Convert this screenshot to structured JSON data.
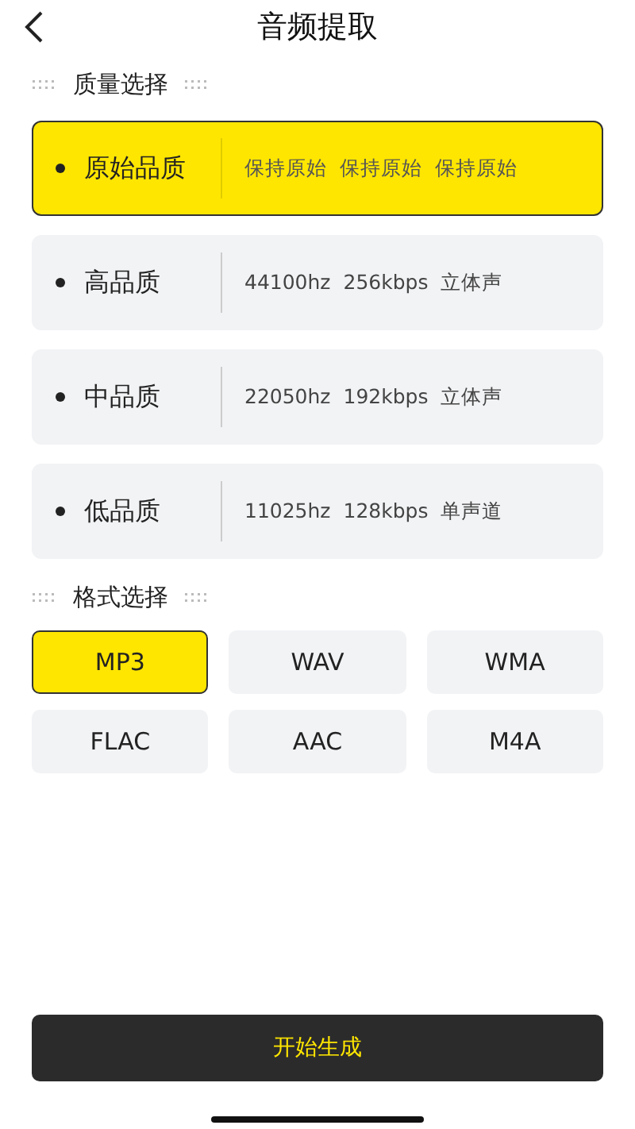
{
  "header": {
    "title": "音频提取"
  },
  "quality_section": {
    "title": "质量选择",
    "options": [
      {
        "name": "原始品质",
        "details": [
          "保持原始",
          "保持原始",
          "保持原始"
        ],
        "selected": true
      },
      {
        "name": "高品质",
        "details": [
          "44100hz",
          "256kbps",
          "立体声"
        ],
        "selected": false
      },
      {
        "name": "中品质",
        "details": [
          "22050hz",
          "192kbps",
          "立体声"
        ],
        "selected": false
      },
      {
        "name": "低品质",
        "details": [
          "11025hz",
          "128kbps",
          "单声道"
        ],
        "selected": false
      }
    ]
  },
  "format_section": {
    "title": "格式选择",
    "options": [
      {
        "label": "MP3",
        "selected": true
      },
      {
        "label": "WAV",
        "selected": false
      },
      {
        "label": "WMA",
        "selected": false
      },
      {
        "label": "FLAC",
        "selected": false
      },
      {
        "label": "AAC",
        "selected": false
      },
      {
        "label": "M4A",
        "selected": false
      }
    ]
  },
  "start_button": {
    "label": "开始生成"
  }
}
